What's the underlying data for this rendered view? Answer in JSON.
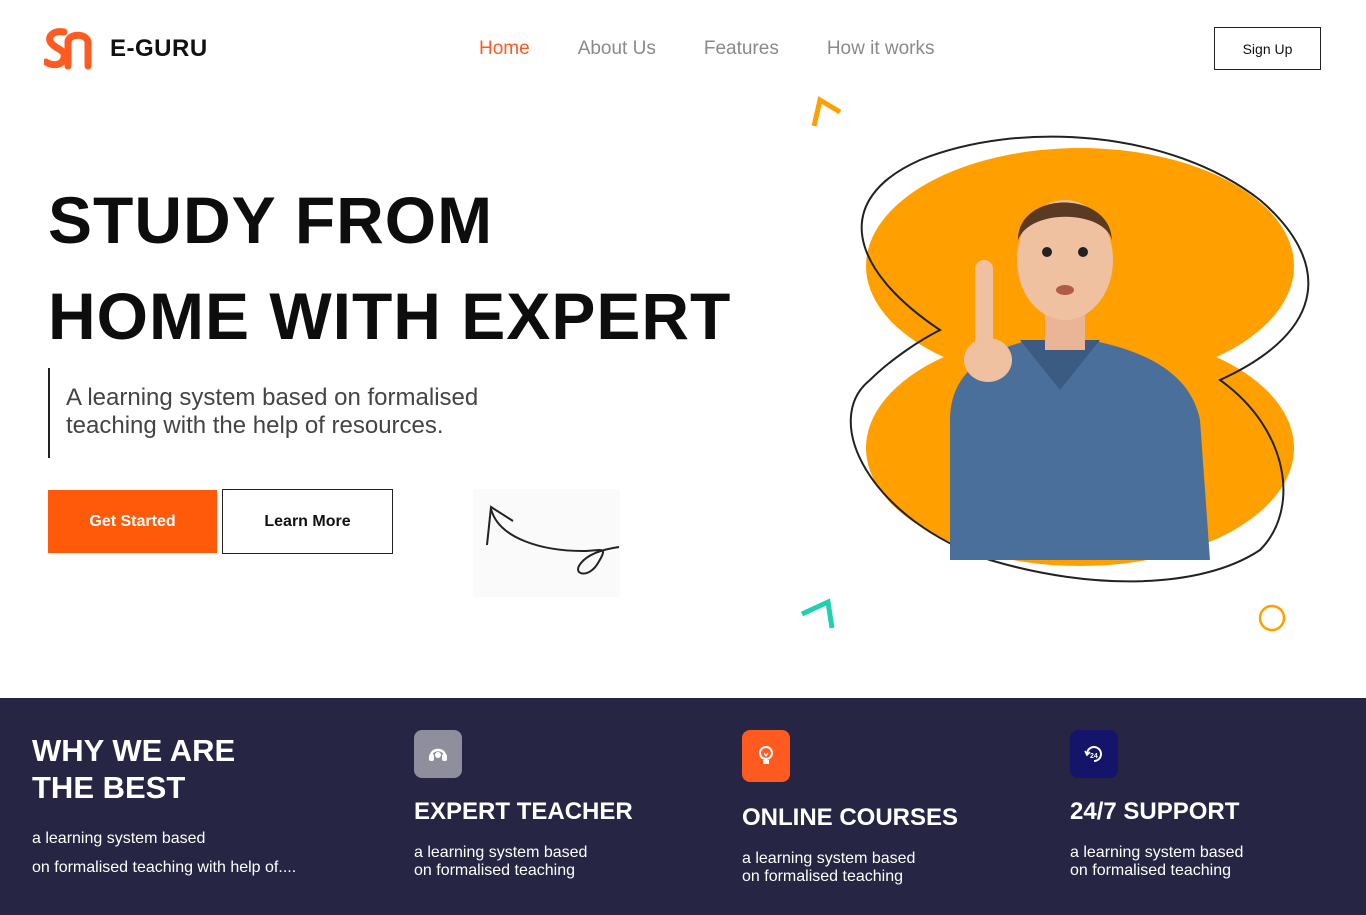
{
  "brand": {
    "name": "E-GURU",
    "accent": "#ff5a1f"
  },
  "nav": {
    "items": [
      {
        "label": "Home",
        "active": true
      },
      {
        "label": "About Us",
        "active": false
      },
      {
        "label": "Features",
        "active": false
      },
      {
        "label": "How it works",
        "active": false
      }
    ],
    "signup_label": "Sign Up"
  },
  "hero": {
    "title_line1": "STUDY FROM",
    "title_line2": "HOME WITH EXPERT",
    "subtitle_line1": "A learning system based on formalised",
    "subtitle_line2": "teaching with the help of resources.",
    "primary_button": "Get Started",
    "secondary_button": "Learn More"
  },
  "why": {
    "title_line1": "WHY WE ARE",
    "title_line2": "THE BEST",
    "desc_line1": "a learning system based",
    "desc_line2": "on formalised teaching with help of...."
  },
  "features": [
    {
      "icon": "headset-icon",
      "icon_color": "#8e8e9c",
      "title": "EXPERT TEACHER",
      "desc_line1": "a learning system based",
      "desc_line2": "on formalised teaching"
    },
    {
      "icon": "lightbulb-icon",
      "icon_color": "#ff5a1f",
      "title": "ONLINE COURSES",
      "desc_line1": "a learning system based",
      "desc_line2": "on formalised teaching"
    },
    {
      "icon": "support-24-icon",
      "icon_color": "#15146b",
      "title": "24/7 SUPPORT",
      "desc_line1": "a learning system based",
      "desc_line2": "on formalised teaching"
    }
  ],
  "colors": {
    "band_bg": "#262544",
    "blob_orange": "#ffa000",
    "teal": "#1fd1b0"
  }
}
